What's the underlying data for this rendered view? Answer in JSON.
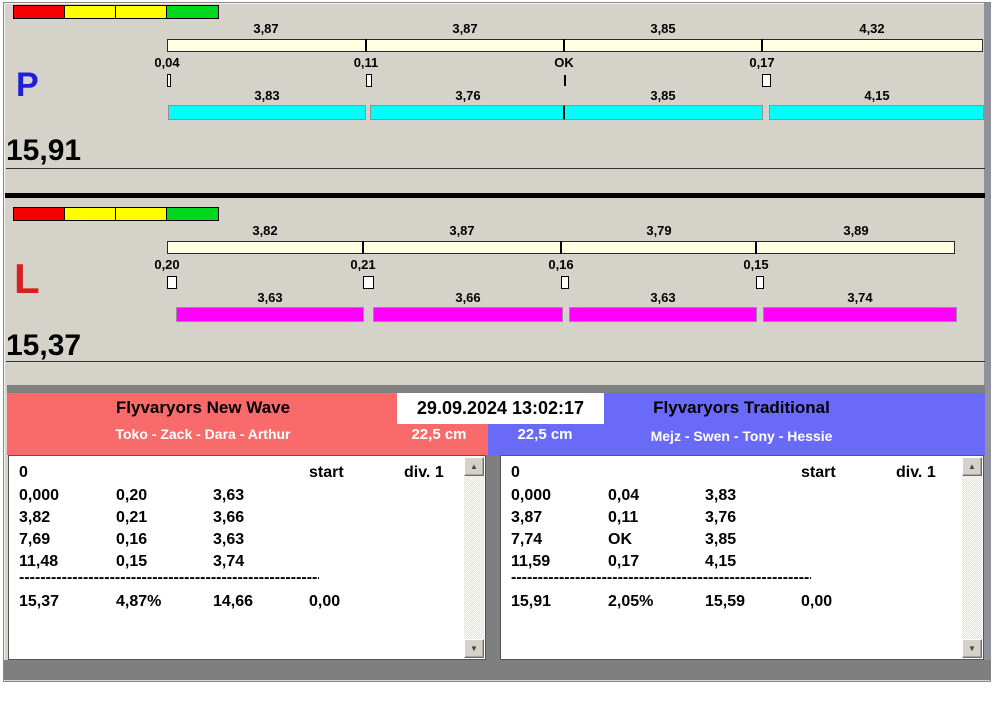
{
  "datetime": "29.09.2024 13:02:17",
  "icons": {
    "scroll_up": "▲",
    "scroll_down": "▼"
  },
  "traffic_strip": {
    "names": [
      "red",
      "yellow",
      "yellow",
      "green"
    ],
    "colors": [
      "#F40000",
      "#FFFF00",
      "#FFFF00",
      "#00D81E"
    ]
  },
  "colors": {
    "split_bar": "#FFFFE2"
  },
  "panels": [
    {
      "letter": "P",
      "letter_color": "#1F1FD6",
      "total": "15,91",
      "bar_color": "#00FFFF",
      "segments": [
        {
          "split": "3,87",
          "split_v": 3.87,
          "exchange": "0,04",
          "exchange_v": 0.04,
          "sector": "3,83",
          "sector_v": 3.83
        },
        {
          "split": "3,87",
          "split_v": 3.87,
          "exchange": "0,11",
          "exchange_v": 0.11,
          "sector": "3,76",
          "sector_v": 3.76
        },
        {
          "split": "3,85",
          "split_v": 3.85,
          "exchange": "OK",
          "exchange_v": 0,
          "sector": "3,85",
          "sector_v": 3.85
        },
        {
          "split": "4,32",
          "split_v": 4.32,
          "exchange": "0,17",
          "exchange_v": 0.17,
          "sector": "4,15",
          "sector_v": 4.15
        }
      ]
    },
    {
      "letter": "L",
      "letter_color": "#D61F1F",
      "total": "15,37",
      "bar_color": "#FF00FF",
      "segments": [
        {
          "split": "3,82",
          "split_v": 3.82,
          "exchange": "0,20",
          "exchange_v": 0.2,
          "sector": "3,63",
          "sector_v": 3.63
        },
        {
          "split": "3,87",
          "split_v": 3.87,
          "exchange": "0,21",
          "exchange_v": 0.21,
          "sector": "3,66",
          "sector_v": 3.66
        },
        {
          "split": "3,79",
          "split_v": 3.79,
          "exchange": "0,16",
          "exchange_v": 0.16,
          "sector": "3,63",
          "sector_v": 3.63
        },
        {
          "split": "3,89",
          "split_v": 3.89,
          "exchange": "0,15",
          "exchange_v": 0.15,
          "sector": "3,74",
          "sector_v": 3.74
        }
      ]
    }
  ],
  "teams": [
    {
      "name": "Flyvaryors New Wave",
      "members": "Toko - Zack - Dara - Arthur",
      "header_color": "#F96A6A",
      "distance": "22,5 cm",
      "table": {
        "first_row": {
          "col0": "0",
          "col3": "start",
          "col4": "div. 1"
        },
        "rows": [
          [
            "0,000",
            "0,20",
            "3,63"
          ],
          [
            "3,82",
            "0,21",
            "3,66"
          ],
          [
            "7,69",
            "0,16",
            "3,63"
          ],
          [
            "11,48",
            "0,15",
            "3,74"
          ]
        ],
        "separator": "------------------------------------------------------------",
        "summary": [
          "15,37",
          "4,87%",
          "14,66",
          "0,00"
        ]
      }
    },
    {
      "name": "Flyvaryors Traditional",
      "members": "Mejz - Swen - Tony - Hessie",
      "header_color": "#6A6AF9",
      "distance": "22,5 cm",
      "table": {
        "first_row": {
          "col0": "0",
          "col3": "start",
          "col4": "div. 1"
        },
        "rows": [
          [
            "0,000",
            "0,04",
            "3,83"
          ],
          [
            "3,87",
            "0,11",
            "3,76"
          ],
          [
            "7,74",
            "OK",
            "3,85"
          ],
          [
            "11,59",
            "0,17",
            "4,15"
          ]
        ],
        "separator": "------------------------------------------------------------",
        "summary": [
          "15,91",
          "2,05%",
          "15,59",
          "0,00"
        ]
      }
    }
  ]
}
